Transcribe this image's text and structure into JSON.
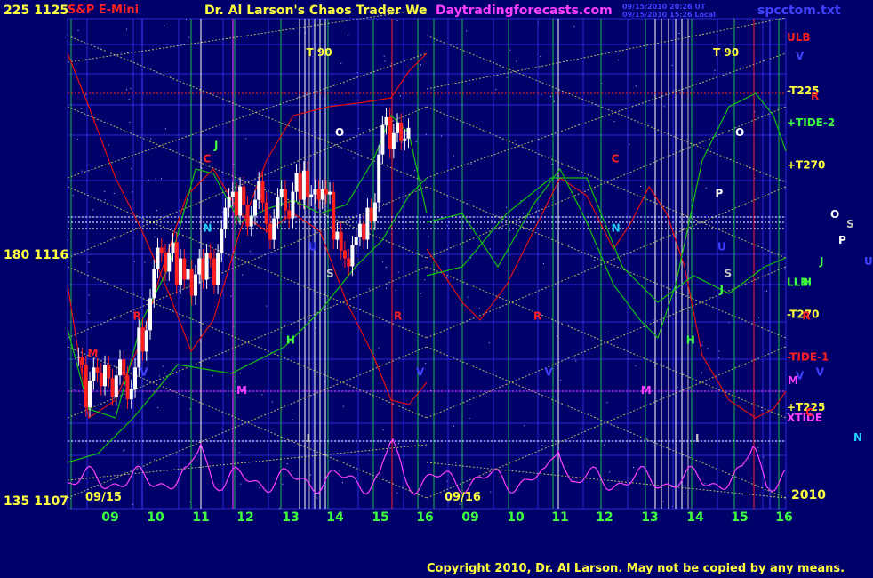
{
  "header": {
    "instrument": "S&P E-Mini",
    "title": "Dr. Al Larson's Chaos Trader We",
    "site": "Daytradingforecasts.com",
    "stamp1": "09/15/2010 20:26 UT",
    "stamp2": "09/15/2010 15:26 Local",
    "file": "spcctom.txt"
  },
  "footer": {
    "copyright": "Copyright 2010, Dr. Al Larson. May not be copied by any means."
  },
  "colors": {
    "background": "#00006a",
    "grid": "#2a2ad8",
    "hour_line": "#1fb84a",
    "diag": "#d8d860",
    "close_up": "#ffffff",
    "close_down": "#ff2020",
    "red_flow": "#e01010",
    "green_flow": "#10c010",
    "magenta_flow": "#ff40ff"
  },
  "chart_data": {
    "type": "candlestick",
    "y_labels_left": [
      {
        "price": 1125,
        "angle": "225"
      },
      {
        "price": 1116,
        "angle": "180"
      },
      {
        "price": 1107,
        "angle": "135"
      }
    ],
    "ylim": [
      1107,
      1125
    ],
    "x_ticks": [
      "09",
      "10",
      "11",
      "12",
      "13",
      "14",
      "15",
      "16",
      "09",
      "10",
      "11",
      "12",
      "13",
      "14",
      "15",
      "16"
    ],
    "day_labels": [
      "09/15",
      "09/16"
    ],
    "year_label": "2010",
    "right_labels": [
      {
        "text": "ULB",
        "price": 1124.3,
        "color": "#ff2020"
      },
      {
        "text": "V",
        "price": 1123.6,
        "color": "#4040ff"
      },
      {
        "text": "-T225",
        "price": 1122.3,
        "color": "#ffff40"
      },
      {
        "text": "R",
        "price": 1122.1,
        "color": "#ff2020"
      },
      {
        "text": "+TIDE-2",
        "price": 1121.1,
        "color": "#40ff40"
      },
      {
        "text": "+T270",
        "price": 1119.5,
        "color": "#ffff40"
      },
      {
        "text": "LLB",
        "price": 1115.1,
        "color": "#40ff40"
      },
      {
        "text": "H",
        "price": 1115.1,
        "color": "#40ff40"
      },
      {
        "text": "-T270",
        "price": 1113.9,
        "color": "#ffff40"
      },
      {
        "text": "-TIDE-1",
        "price": 1112.3,
        "color": "#ff2020"
      },
      {
        "text": "V",
        "price": 1111.6,
        "color": "#4040ff"
      },
      {
        "text": "M",
        "price": 1111.4,
        "color": "#ff40ff"
      },
      {
        "text": "+T225",
        "price": 1110.4,
        "color": "#ffff40"
      },
      {
        "text": "XTIDE",
        "price": 1110.0,
        "color": "#ff40ff"
      },
      {
        "text": "C",
        "price": 1110.2,
        "color": "#ff2020"
      }
    ],
    "legend": [
      {
        "text": "O",
        "color": "#ffffff"
      },
      {
        "text": "S",
        "color": "#c0c0c0"
      },
      {
        "text": "P",
        "color": "#ffffff"
      },
      {
        "text": "J",
        "color": "#40ff40"
      },
      {
        "text": "U",
        "color": "#4040ff"
      },
      {
        "text": "N",
        "color": "#20d0ff"
      }
    ],
    "markers": [
      {
        "text": "T  90",
        "hour": 13.35,
        "price": 1123.6,
        "color": "#ffff40"
      },
      {
        "text": "O",
        "hour": 14.0,
        "price": 1120.6,
        "color": "#ffffff"
      },
      {
        "text": "C",
        "hour": 11.05,
        "price": 1119.6,
        "color": "#ff2020"
      },
      {
        "text": "N",
        "hour": 11.05,
        "price": 1117.0,
        "color": "#20d0ff"
      },
      {
        "text": "J",
        "hour": 11.3,
        "price": 1120.1,
        "color": "#40ff40"
      },
      {
        "text": "U",
        "hour": 13.4,
        "price": 1116.3,
        "color": "#4040ff"
      },
      {
        "text": "S",
        "hour": 13.8,
        "price": 1115.3,
        "color": "#c0c0c0"
      },
      {
        "text": "R",
        "hour": 9.5,
        "price": 1113.7,
        "color": "#ff2020"
      },
      {
        "text": "H",
        "hour": 12.9,
        "price": 1112.8,
        "color": "#40ff40"
      },
      {
        "text": "M",
        "hour": 11.8,
        "price": 1110.9,
        "color": "#ff40ff"
      },
      {
        "text": "V",
        "hour": 9.65,
        "price": 1111.6,
        "color": "#4040ff"
      },
      {
        "text": "V",
        "hour": 15.8,
        "price": 1111.6,
        "color": "#4040ff"
      },
      {
        "text": "R",
        "hour": 15.3,
        "price": 1113.7,
        "color": "#ff2020"
      },
      {
        "text": "M",
        "hour": 8.5,
        "price": 1112.3,
        "color": "#ff2020"
      },
      {
        "text": "I",
        "hour": 13.35,
        "price": 1109.1,
        "color": "#c0c0c0"
      },
      {
        "text": "T  90",
        "hour": 22.4,
        "price": 1123.6,
        "color": "#ffff40"
      },
      {
        "text": "O",
        "hour": 22.9,
        "price": 1120.6,
        "color": "#ffffff"
      },
      {
        "text": "C",
        "hour": 20.15,
        "price": 1119.6,
        "color": "#ff2020"
      },
      {
        "text": "N",
        "hour": 20.15,
        "price": 1117.0,
        "color": "#20d0ff"
      },
      {
        "text": "P",
        "hour": 22.45,
        "price": 1118.3,
        "color": "#ffffff"
      },
      {
        "text": "U",
        "hour": 22.5,
        "price": 1116.3,
        "color": "#4040ff"
      },
      {
        "text": "S",
        "hour": 22.65,
        "price": 1115.3,
        "color": "#c0c0c0"
      },
      {
        "text": "J",
        "hour": 22.55,
        "price": 1114.7,
        "color": "#40ff40"
      },
      {
        "text": "R",
        "hour": 18.4,
        "price": 1113.7,
        "color": "#ff2020"
      },
      {
        "text": "V",
        "hour": 18.65,
        "price": 1111.6,
        "color": "#4040ff"
      },
      {
        "text": "H",
        "hour": 21.8,
        "price": 1112.8,
        "color": "#40ff40"
      },
      {
        "text": "M",
        "hour": 20.8,
        "price": 1110.9,
        "color": "#ff40ff"
      },
      {
        "text": "I",
        "hour": 22.0,
        "price": 1109.1,
        "color": "#c0c0c0"
      },
      {
        "text": "R",
        "hour": 24.4,
        "price": 1113.7,
        "color": "#ff2020"
      },
      {
        "text": "V",
        "hour": 24.7,
        "price": 1111.6,
        "color": "#4040ff"
      }
    ],
    "closes": [
      1112.3,
      1112.0,
      1110.4,
      1111.4,
      1111.9,
      1111.7,
      1111.2,
      1112.0,
      1111.5,
      1110.8,
      1111.6,
      1112.2,
      1111.6,
      1110.7,
      1111.1,
      1111.9,
      1113.4,
      1112.5,
      1113.3,
      1114.5,
      1115.6,
      1116.4,
      1116.2,
      1115.5,
      1116.2,
      1116.6,
      1115.0,
      1116.0,
      1115.2,
      1115.6,
      1114.6,
      1115.4,
      1116.0,
      1115.2,
      1116.2,
      1116.0,
      1115.0,
      1116.2,
      1117.1,
      1117.9,
      1118.3,
      1118.5,
      1117.6,
      1118.7,
      1118.0,
      1117.2,
      1117.6,
      1118.2,
      1118.9,
      1118.1,
      1117.3,
      1116.7,
      1117.5,
      1118.3,
      1118.6,
      1117.8,
      1117.5,
      1118.5,
      1119.2,
      1118.2,
      1119.3,
      1118.3,
      1118.4,
      1118.6,
      1118.2,
      1118.6,
      1118.4,
      1118.5,
      1116.7,
      1117.0,
      1116.3,
      1116.0,
      1115.7,
      1116.5,
      1116.8,
      1117.3,
      1116.7,
      1117.9,
      1117.4,
      1118.1,
      1119.9,
      1121.0,
      1121.3,
      1120.1,
      1120.7,
      1121.1,
      1120.4,
      1120.5,
      1120.9
    ],
    "first_close_hour": 8.3,
    "bar_interval_hours": 0.0833
  }
}
